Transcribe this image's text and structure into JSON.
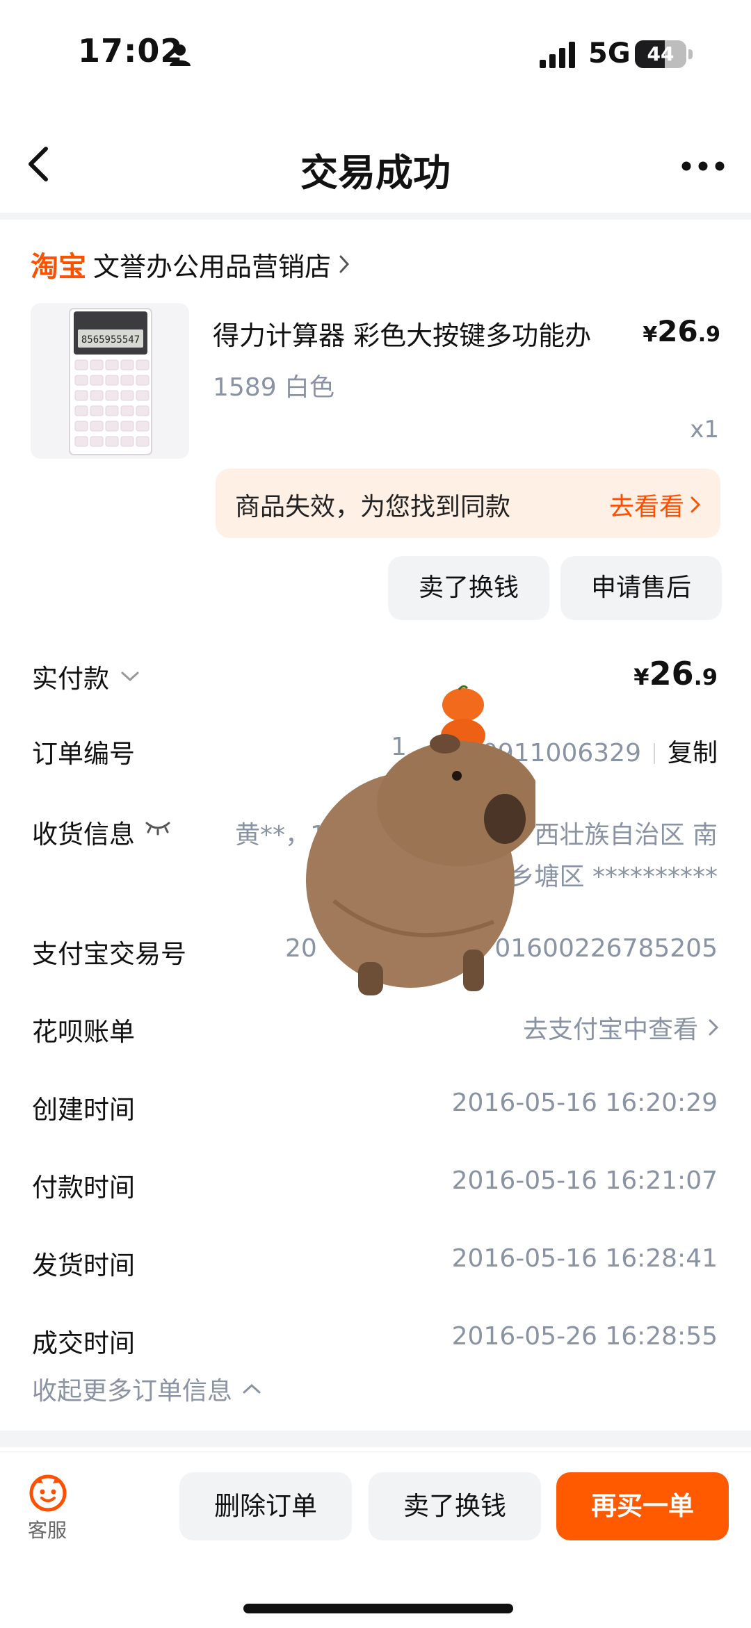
{
  "status_bar": {
    "time": "17:02",
    "network": "5G",
    "battery": "44"
  },
  "nav": {
    "title": "交易成功"
  },
  "shop": {
    "logo": "淘宝",
    "name": "文誉办公用品营销店"
  },
  "product": {
    "title": "得力计算器 彩色大按键多功能办",
    "price_symbol": "¥",
    "price_int": "26",
    "price_dec": ".9",
    "spec": "1589 白色",
    "qty": "x1",
    "calc_display": "8565955547"
  },
  "invalid_notice": {
    "text": "商品失效，为您找到同款",
    "link": "去看看"
  },
  "item_actions": {
    "sell": "卖了换钱",
    "after_sale": "申请售后"
  },
  "order_info": {
    "paid_label": "实付款",
    "paid_symbol": "¥",
    "paid_int": "26",
    "paid_dec": ".9",
    "order_no_label": "订单编号",
    "order_no_prefix": "1",
    "order_no_suffix": "0911006329",
    "copy": "复制",
    "shipping_label": "收货信息",
    "shipping_line1_a": "黄**，1",
    "shipping_line1_b": "西壮族自治区 南",
    "shipping_line2": "乡塘区 **********",
    "alipay_label": "支付宝交易号",
    "alipay_prefix": "20",
    "alipay_suffix": "01600226785205",
    "huabei_label": "花呗账单",
    "huabei_link": "去支付宝中查看",
    "created_label": "创建时间",
    "created": "2016-05-16 16:20:29",
    "paid_time_label": "付款时间",
    "paid_time": "2016-05-16 16:21:07",
    "shipped_label": "发货时间",
    "shipped": "2016-05-16 16:28:41",
    "closed_label": "成交时间",
    "closed": "2016-05-26 16:28:55",
    "collapse": "收起更多订单信息"
  },
  "bottom_bar": {
    "service": "客服",
    "delete": "删除订单",
    "sell": "卖了换钱",
    "rebuy": "再买一单"
  },
  "colors": {
    "accent": "#ff5000",
    "muted": "#8a93a3",
    "banner_bg": "#fff0e6"
  },
  "icons": [
    "person-icon",
    "signal-icon",
    "back-icon",
    "more-icon",
    "chevron-right-icon",
    "chevron-down-icon",
    "eye-closed-icon",
    "chevron-up-icon",
    "service-icon"
  ]
}
